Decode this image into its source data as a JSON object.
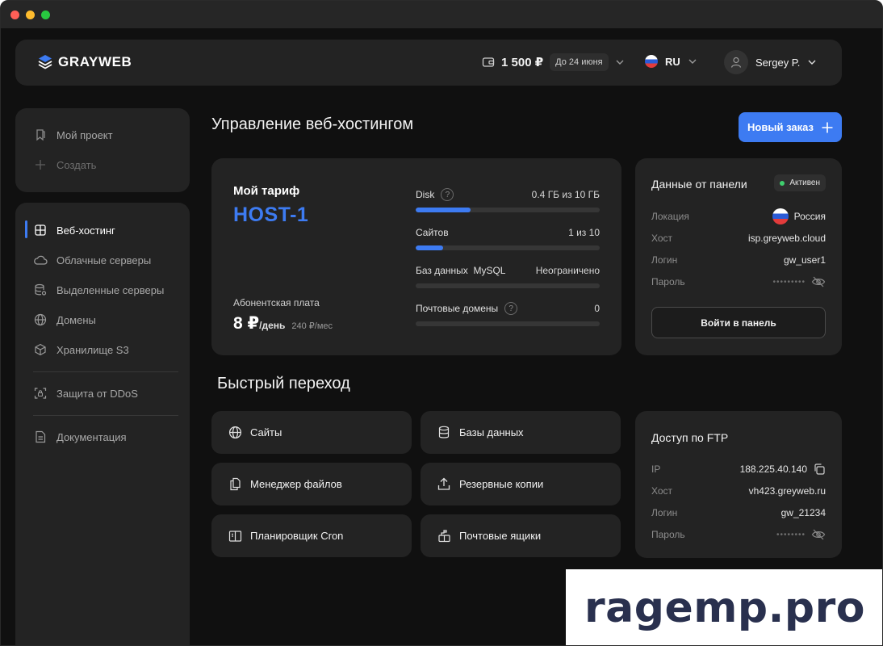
{
  "brand": {
    "name": "GRAYWEB"
  },
  "header": {
    "balance": "1 500 ₽",
    "due_date": "До 24 июня",
    "language": "RU",
    "user_name": "Sergey P."
  },
  "sidebar": {
    "project": [
      {
        "label": "Мой проект",
        "icon": "bookmark-icon"
      },
      {
        "label": "Создать",
        "icon": "plus-icon"
      }
    ],
    "items": [
      {
        "label": "Веб-хостинг",
        "icon": "grid-icon"
      },
      {
        "label": "Облачные серверы",
        "icon": "cloud-icon"
      },
      {
        "label": "Выделенные серверы",
        "icon": "database-gear-icon"
      },
      {
        "label": "Домены",
        "icon": "globe-icon"
      },
      {
        "label": "Хранилище S3",
        "icon": "box-icon"
      },
      {
        "label": "Защита от DDoS",
        "icon": "shield-scan-icon"
      },
      {
        "label": "Документация",
        "icon": "document-icon"
      }
    ]
  },
  "main": {
    "title": "Управление веб-хостингом",
    "new_order_label": "Новый заказ"
  },
  "tariff": {
    "label": "Мой тариф",
    "name": "HOST-1",
    "fee_label": "Абонентская плата",
    "fee_main": "8 ₽",
    "fee_unit": "/день",
    "fee_month": "240 ₽/мес",
    "usage": [
      {
        "label": "Disk",
        "help": true,
        "value": "0.4 ГБ из 10 ГБ",
        "fill": 0.3
      },
      {
        "label": "Сайтов",
        "help": false,
        "value": "1 из 10",
        "fill": 0.15
      },
      {
        "label": "Баз данных  MySQL",
        "help": false,
        "value": "Неограничено",
        "fill": 0
      },
      {
        "label": "Почтовые домены",
        "help": true,
        "value": "0",
        "fill": 0
      }
    ]
  },
  "panel": {
    "title": "Данные от панели",
    "status": "Активен",
    "rows": [
      {
        "key": "Локация",
        "value": "Россия"
      },
      {
        "key": "Хост",
        "value": "isp.greyweb.cloud"
      },
      {
        "key": "Логин",
        "value": "gw_user1"
      },
      {
        "key": "Пароль",
        "value": "•••••••••"
      }
    ],
    "button": "Войти в панель"
  },
  "quick": {
    "title": "Быстрый переход",
    "items": [
      {
        "label": "Сайты",
        "icon": "globe-icon"
      },
      {
        "label": "Базы данных",
        "icon": "database-icon"
      },
      {
        "label": "Менеджер файлов",
        "icon": "files-icon"
      },
      {
        "label": "Резервные копии",
        "icon": "upload-icon"
      },
      {
        "label": "Планировщик Cron",
        "icon": "book-icon"
      },
      {
        "label": "Почтовые ящики",
        "icon": "mailbox-icon"
      }
    ]
  },
  "ftp": {
    "title": "Доступ по FTP",
    "rows": [
      {
        "key": "IP",
        "value": "188.225.40.140"
      },
      {
        "key": "Хост",
        "value": "vh423.greyweb.ru"
      },
      {
        "key": "Логин",
        "value": "gw_21234"
      },
      {
        "key": "Пароль",
        "value": "••••••••"
      }
    ]
  },
  "watermark": "ragemp.pro",
  "colors": {
    "accent": "#3d7bf2",
    "status_ok": "#3fcf6e",
    "card": "#232323",
    "background": "#101010"
  }
}
